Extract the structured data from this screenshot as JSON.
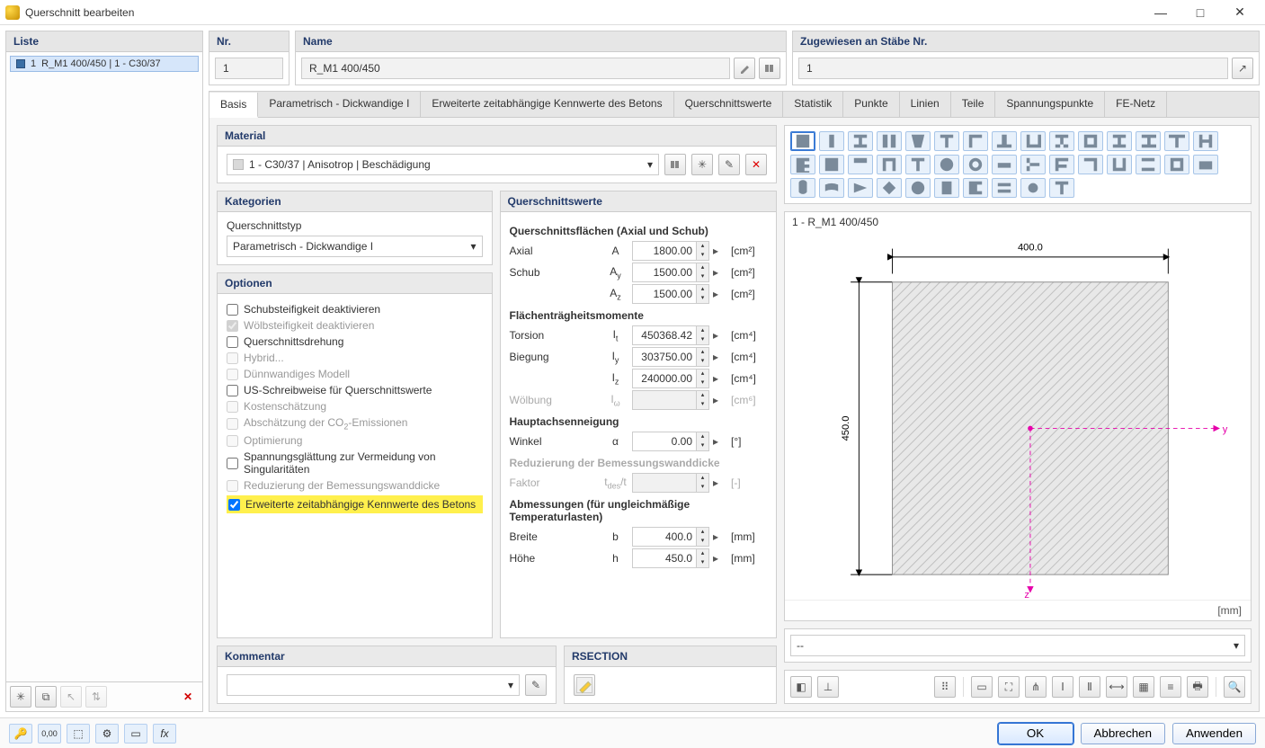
{
  "window": {
    "title": "Querschnitt bearbeiten"
  },
  "list": {
    "head": "Liste",
    "item1_num": "1",
    "item1_label": "R_M1 400/450 | 1 - C30/37"
  },
  "nr": {
    "head": "Nr.",
    "value": "1"
  },
  "name": {
    "head": "Name",
    "value": "R_M1 400/450"
  },
  "assign": {
    "head": "Zugewiesen an Stäbe Nr.",
    "value": "1"
  },
  "tabs": {
    "basis": "Basis",
    "param": "Parametrisch - Dickwandige I",
    "ext": "Erweiterte zeitabhängige Kennwerte des Betons",
    "qswerte": "Querschnittswerte",
    "stat": "Statistik",
    "punkte": "Punkte",
    "linien": "Linien",
    "teile": "Teile",
    "span": "Spannungspunkte",
    "fe": "FE-Netz"
  },
  "material": {
    "head": "Material",
    "value": "1 - C30/37 | Anisotrop | Beschädigung"
  },
  "kategorien": {
    "head": "Kategorien",
    "typ_label": "Querschnittstyp",
    "typ_value": "Parametrisch - Dickwandige I"
  },
  "optionen": {
    "head": "Optionen",
    "o1": "Schubsteifigkeit deaktivieren",
    "o2": "Wölbsteifigkeit deaktivieren",
    "o3": "Querschnittsdrehung",
    "o4": "Hybrid...",
    "o5": "Dünnwandiges Modell",
    "o6": "US-Schreibweise für Querschnittswerte",
    "o7": "Kostenschätzung",
    "o8": "Abschätzung der CO2-Emissionen",
    "o8_sub": "2",
    "o9": "Optimierung",
    "o10": "Spannungsglättung zur Vermeidung von Singularitäten",
    "o11": "Reduzierung der Bemessungswanddicke",
    "o12": "Erweiterte zeitabhängige Kennwerte des Betons"
  },
  "qswerte": {
    "head": "Querschnittswerte",
    "sec1": "Querschnittsflächen (Axial und Schub)",
    "axial": "Axial",
    "axial_sym": "A",
    "axial_val": "1800.00",
    "axial_unit": "[cm²]",
    "schub": "Schub",
    "ay_sym": "Ay",
    "ay_val": "1500.00",
    "ay_unit": "[cm²]",
    "az_sym": "Az",
    "az_val": "1500.00",
    "az_unit": "[cm²]",
    "sec2": "Flächenträgheitsmomente",
    "torsion": "Torsion",
    "it_sym": "It",
    "it_val": "450368.42",
    "it_unit": "[cm⁴]",
    "biegung": "Biegung",
    "iy_sym": "Iy",
    "iy_val": "303750.00",
    "iy_unit": "[cm⁴]",
    "iz_sym": "Iz",
    "iz_val": "240000.00",
    "iz_unit": "[cm⁴]",
    "wolbung": "Wölbung",
    "iw_sym": "Iω",
    "iw_unit": "[cm⁶]",
    "sec3": "Hauptachsenneigung",
    "winkel": "Winkel",
    "alpha_sym": "α",
    "alpha_val": "0.00",
    "alpha_unit": "[°]",
    "sec4": "Reduzierung der Bemessungswanddicke",
    "faktor": "Faktor",
    "faktor_sym": "tdes/t",
    "faktor_unit": "[-]",
    "sec5": "Abmessungen (für ungleichmäßige Temperaturlasten)",
    "breite": "Breite",
    "b_sym": "b",
    "b_val": "400.0",
    "b_unit": "[mm]",
    "hoehe": "Höhe",
    "h_sym": "h",
    "h_val": "450.0",
    "h_unit": "[mm]"
  },
  "preview": {
    "title": "1 - R_M1 400/450",
    "dim_w": "400.0",
    "dim_h": "450.0",
    "unit": "[mm]"
  },
  "kommentar": {
    "head": "Kommentar"
  },
  "rsection": {
    "head": "RSECTION"
  },
  "bottom_selector": {
    "dash": "--"
  },
  "buttons": {
    "ok": "OK",
    "cancel": "Abbrechen",
    "apply": "Anwenden"
  }
}
